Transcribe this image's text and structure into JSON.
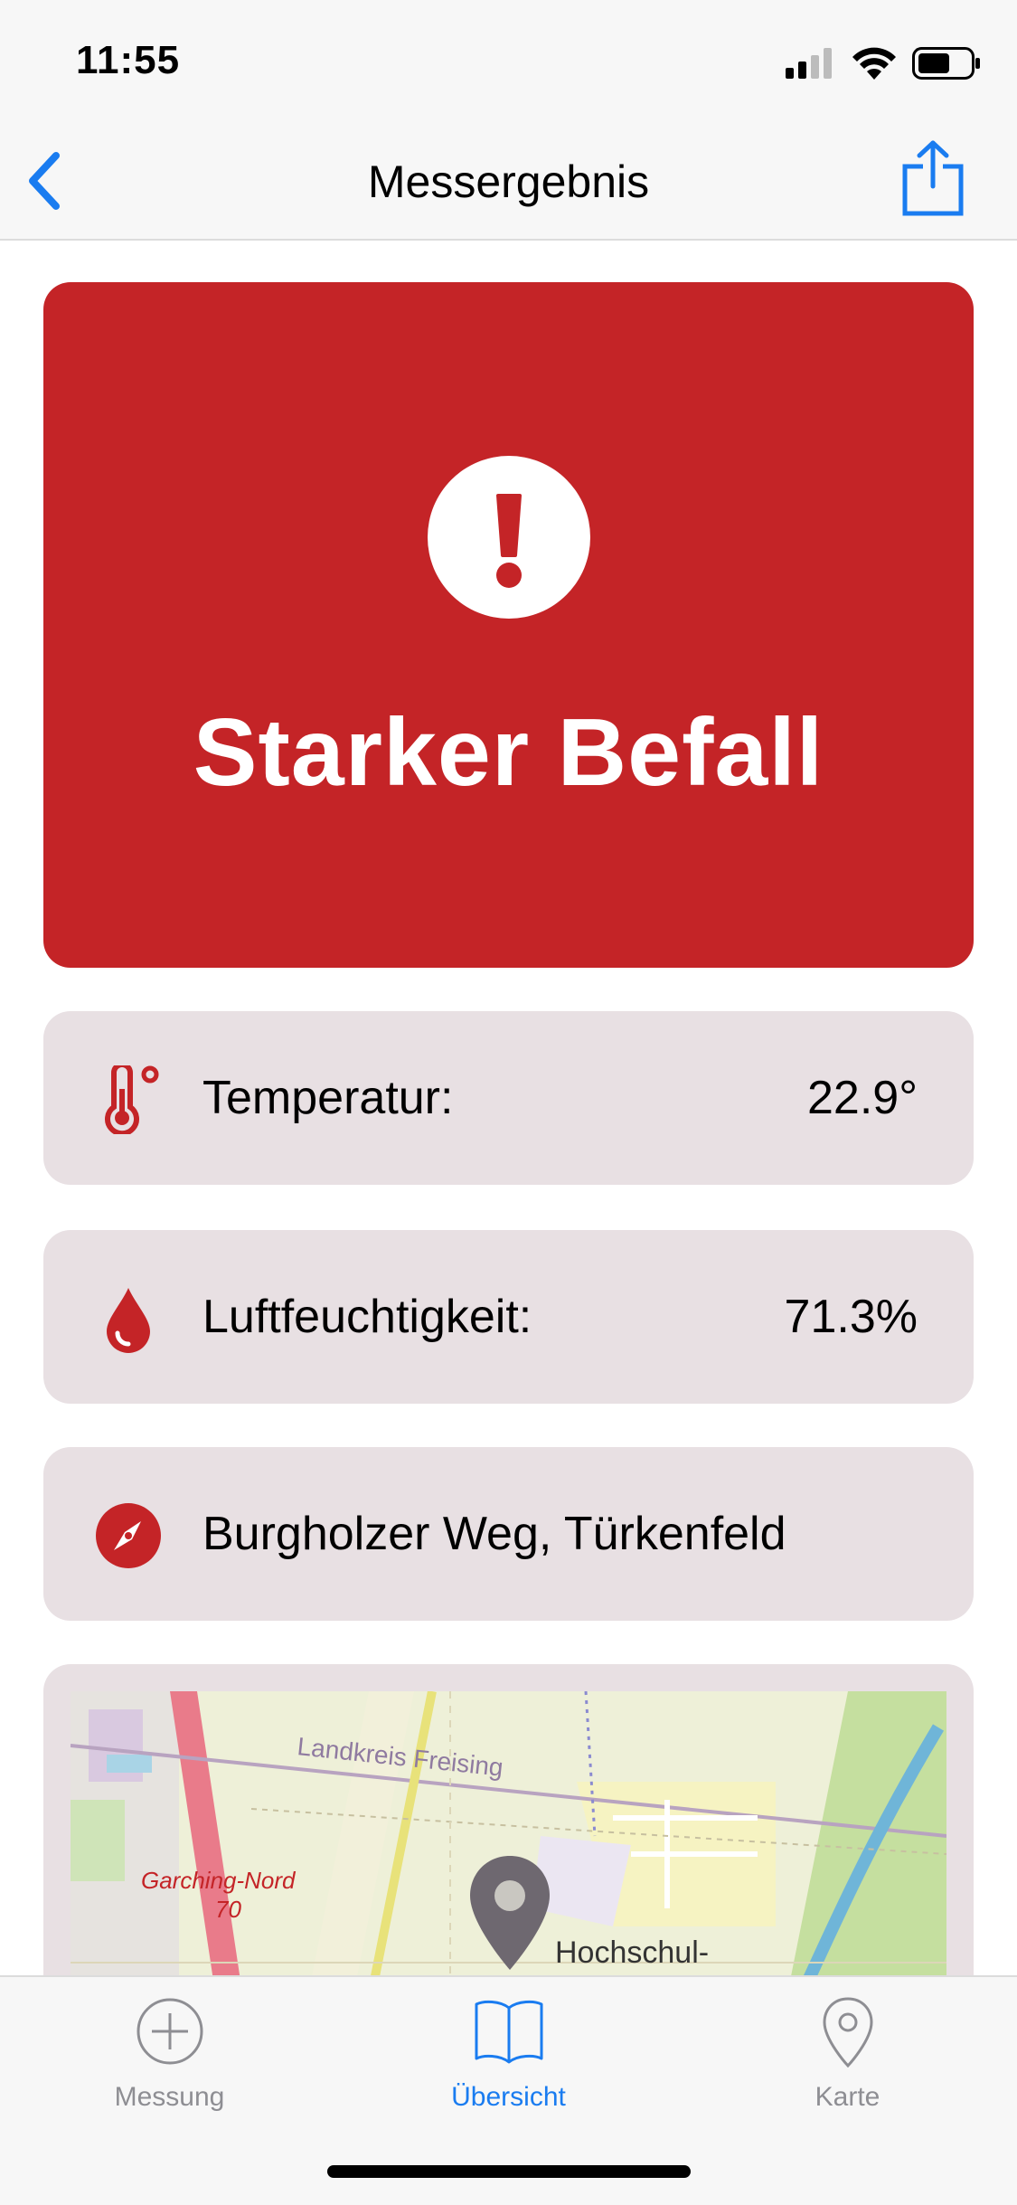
{
  "status_bar": {
    "time": "11:55"
  },
  "nav": {
    "title": "Messergebnis"
  },
  "alert": {
    "title": "Starker Befall",
    "color": "#c42427"
  },
  "readings": [
    {
      "label": "Temperatur:",
      "value": "22.9°",
      "icon": "thermometer-icon"
    },
    {
      "label": "Luftfeuchtigkeit:",
      "value": "71.3%",
      "icon": "drop-icon"
    }
  ],
  "location": {
    "label": "Burgholzer Weg, Türkenfeld",
    "icon": "compass-icon"
  },
  "map": {
    "labels": {
      "district": "Landkreis Freising",
      "station": "Garching-Nord",
      "station_num": "70",
      "place": "Hochschul-"
    }
  },
  "tabs": [
    {
      "label": "Messung",
      "icon": "plus-circle-icon",
      "active": false
    },
    {
      "label": "Übersicht",
      "icon": "book-icon",
      "active": true
    },
    {
      "label": "Karte",
      "icon": "map-pin-icon",
      "active": false
    }
  ],
  "colors": {
    "accent": "#1a7cf0",
    "danger": "#c42427",
    "card": "#e8e0e3"
  }
}
